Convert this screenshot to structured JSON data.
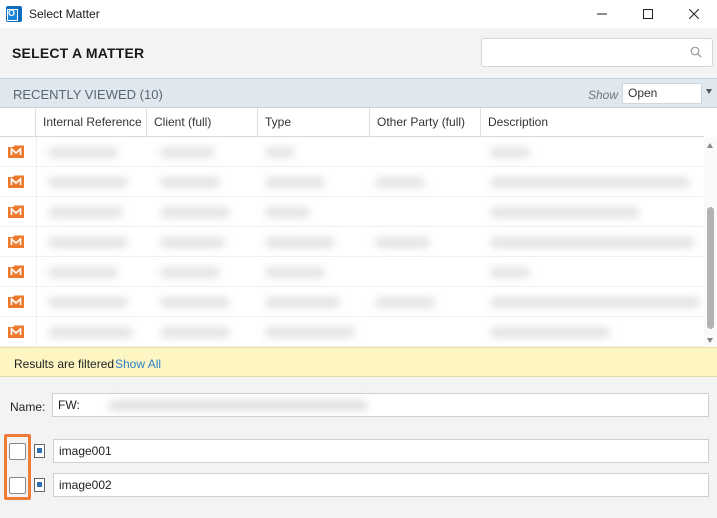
{
  "window": {
    "title": "Select Matter",
    "minimize": "–",
    "maximize": "☐",
    "close": "✕"
  },
  "header": {
    "title": "SELECT A MATTER",
    "search_value": "",
    "search_placeholder": ""
  },
  "recent": {
    "title": "RECENTLY VIEWED (10)",
    "show_label": "Show",
    "show_value": "Open"
  },
  "grid": {
    "columns": [
      "Internal Reference",
      "Client (full)",
      "Type",
      "Other Party (full)",
      "Description"
    ],
    "row_count": 7,
    "row_icon": "matter-folder-icon"
  },
  "filter": {
    "text": "Results are filtered",
    "link": "Show All"
  },
  "form": {
    "name_label": "Name:",
    "name_value": "FW:",
    "attachments": [
      {
        "name": "image001",
        "checked": false
      },
      {
        "name": "image002",
        "checked": false
      }
    ]
  },
  "colors": {
    "accent_orange": "#ef7d39",
    "matter_icon": "#ee7a2e",
    "link_blue": "#2f80c7",
    "filter_bg": "#fdf6c3",
    "recent_bg": "#dfe7ef"
  }
}
